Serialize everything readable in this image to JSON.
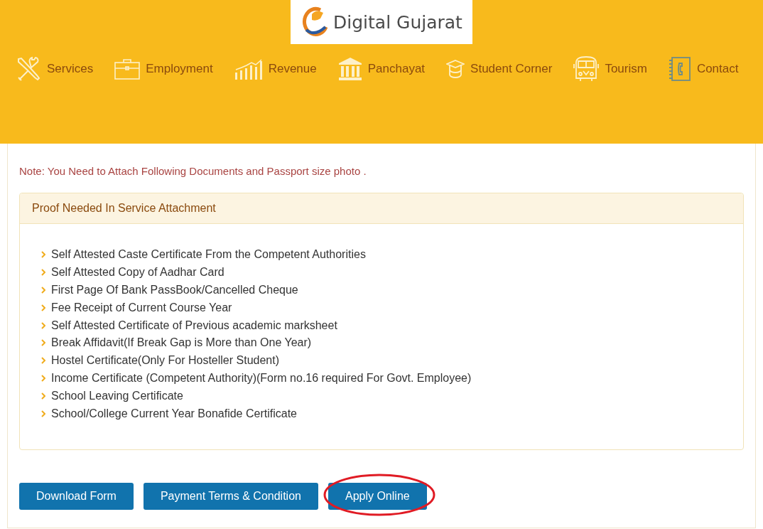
{
  "logo": {
    "title": "Digital Gujarat"
  },
  "nav": [
    {
      "label": "Services",
      "kind": "tools"
    },
    {
      "label": "Employment",
      "kind": "briefcase"
    },
    {
      "label": "Revenue",
      "kind": "chart"
    },
    {
      "label": "Panchayat",
      "kind": "building"
    },
    {
      "label": "Student Corner",
      "kind": "cap"
    },
    {
      "label": "Tourism",
      "kind": "bus"
    },
    {
      "label": "Contact",
      "kind": "phonebook"
    }
  ],
  "note": "Note: You Need to Attach Following Documents and Passport size photo .",
  "panel": {
    "title": "Proof Needed In Service Attachment",
    "items": [
      "Self Attested Caste Certificate From the Competent Authorities",
      "Self Attested Copy of Aadhar Card",
      "First Page Of Bank PassBook/Cancelled Cheque",
      "Fee Receipt of Current Course Year",
      "Self Attested Certificate of Previous academic marksheet",
      "Break Affidavit(If Break Gap is More than One Year)",
      "Hostel Certificate(Only For Hosteller Student)",
      "Income Certificate (Competent Authority)(Form no.16 required For Govt. Employee)",
      "School Leaving Certificate",
      "School/College Current Year Bonafide Certificate"
    ]
  },
  "buttons": [
    {
      "label": "Download Form",
      "circled": false
    },
    {
      "label": "Payment Terms & Condition",
      "circled": false
    },
    {
      "label": "Apply Online",
      "circled": true
    }
  ]
}
